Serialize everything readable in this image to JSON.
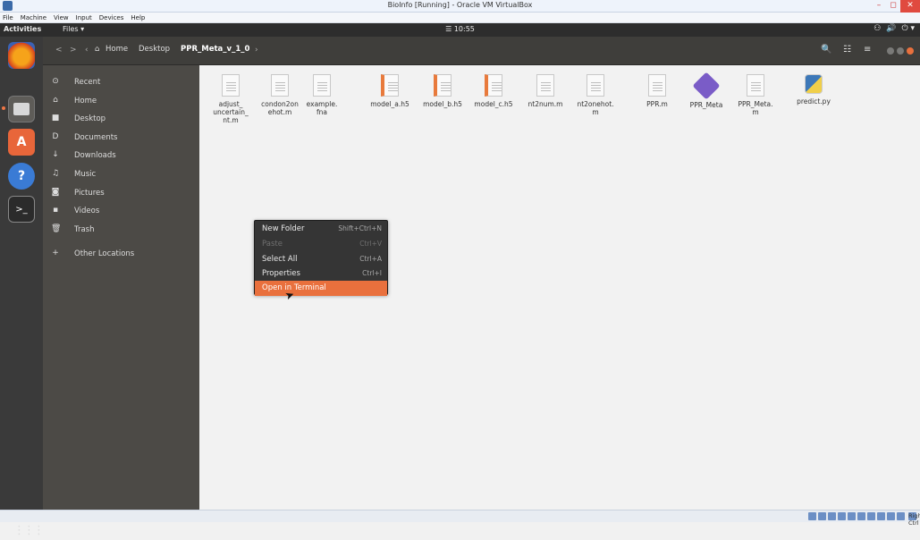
{
  "vbox": {
    "title": "BioInfo [Running] - Oracle VM VirtualBox",
    "menu": [
      "File",
      "Machine",
      "View",
      "Input",
      "Devices",
      "Help"
    ],
    "controls": {
      "minimize": "–",
      "restore": "◻",
      "close": "✕"
    }
  },
  "topbar": {
    "activities": "Activities",
    "files_menu": "Files ▾",
    "clock": "☰ 10:55",
    "tray": [
      "⚇",
      "🔊",
      "⏻ ▾"
    ]
  },
  "header": {
    "back": "<",
    "forward": ">",
    "left_arrow": "‹",
    "home_icon": "⌂",
    "crumbs": [
      "Home",
      "Desktop",
      "PPR_Meta_v_1_0"
    ],
    "right_arrow": "›",
    "search_icon": "🔍",
    "view_icon": "☷",
    "menu_icon": "≡"
  },
  "sidebar": {
    "items": [
      {
        "icon": "⊙",
        "label": "Recent"
      },
      {
        "icon": "⌂",
        "label": "Home"
      },
      {
        "icon": "■",
        "label": "Desktop"
      },
      {
        "icon": "D",
        "label": "Documents"
      },
      {
        "icon": "↓",
        "label": "Downloads"
      },
      {
        "icon": "♫",
        "label": "Music"
      },
      {
        "icon": "◙",
        "label": "Pictures"
      },
      {
        "icon": "▪",
        "label": "Videos"
      },
      {
        "icon": "🗑",
        "label": "Trash"
      },
      {
        "icon": "+",
        "label": "Other Locations"
      }
    ]
  },
  "files": [
    {
      "name_lines": [
        "adjust_",
        "uncertain_",
        "nt.m"
      ],
      "icon": "doc"
    },
    {
      "name_lines": [
        "condon2on",
        "ehot.m"
      ],
      "icon": "doc"
    },
    {
      "name_lines": [
        "example.",
        "fna"
      ],
      "icon": "doc"
    },
    {
      "name_lines": [
        "model_a.h5"
      ],
      "icon": "orange"
    },
    {
      "name_lines": [
        "model_b.h5"
      ],
      "icon": "orange"
    },
    {
      "name_lines": [
        "model_c.h5"
      ],
      "icon": "orange"
    },
    {
      "name_lines": [
        "nt2num.m"
      ],
      "icon": "doc"
    },
    {
      "name_lines": [
        "nt2onehot.",
        "m"
      ],
      "icon": "doc"
    },
    {
      "name_lines": [
        "PPR.m"
      ],
      "icon": "doc"
    },
    {
      "name_lines": [
        "PPR_Meta"
      ],
      "icon": "gem"
    },
    {
      "name_lines": [
        "PPR_Meta.",
        "m"
      ],
      "icon": "doc"
    },
    {
      "name_lines": [
        "predict.py"
      ],
      "icon": "py"
    }
  ],
  "context_menu": [
    {
      "label": "New Folder",
      "shortcut": "Shift+Ctrl+N",
      "state": "normal"
    },
    {
      "label": "Paste",
      "shortcut": "Ctrl+V",
      "state": "disabled"
    },
    {
      "label": "Select All",
      "shortcut": "Ctrl+A",
      "state": "normal"
    },
    {
      "label": "Properties",
      "shortcut": "Ctrl+I",
      "state": "normal"
    },
    {
      "label": "Open in Terminal",
      "shortcut": "",
      "state": "highlighted"
    }
  ],
  "statusbar": {
    "host_key": "Right Ctrl"
  },
  "colors": {
    "accent": "#e9703d",
    "sidebar_bg": "#4c4a46",
    "header_bg": "#3f3e3b",
    "dock_bg": "#3a3a3a"
  }
}
